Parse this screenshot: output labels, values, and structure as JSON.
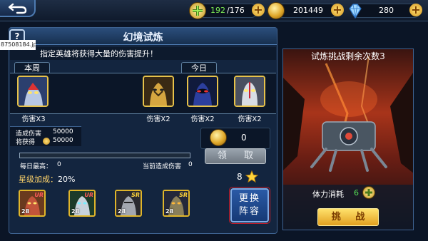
{
  "topbar": {
    "stamina_current": "192",
    "stamina_max": "/176",
    "gold": "201449",
    "diamonds": "280"
  },
  "window": {
    "title": "幻境试炼",
    "help_label": "?",
    "image_tooltip": "87508184.jpg",
    "description": "指定英雄将获得大量的伤害提升！"
  },
  "weekly": {
    "tab_label": "本周",
    "heroes": [
      {
        "icon": "hero-portrait-icon",
        "multiplier": "伤害X3"
      }
    ]
  },
  "today": {
    "tab_label": "今日",
    "heroes": [
      {
        "icon": "hero-portrait-icon",
        "multiplier": "伤害X2"
      },
      {
        "icon": "hero-portrait-icon",
        "multiplier": "伤害X2"
      },
      {
        "icon": "hero-portrait-icon",
        "multiplier": "伤害X2"
      }
    ]
  },
  "damage": {
    "dealt_label": "造成伤害",
    "dealt_value": "50000",
    "earn_label": "将获得",
    "earn_value": "50000"
  },
  "reward": {
    "count": "0",
    "claim_label": "领 取"
  },
  "progress": {
    "fill_fraction": 0.0,
    "daily_max_label": "每日最高：",
    "daily_max_value": "0",
    "current_label": "当前造成伤害",
    "current_value": "0"
  },
  "star_bonus": {
    "label": "星级加成：",
    "value": "20%",
    "star_count": "8"
  },
  "lineup": {
    "cards": [
      {
        "level": "28",
        "rank": "UR",
        "rank_color": "#ff5a5a"
      },
      {
        "level": "28",
        "rank": "UR",
        "rank_color": "#ff5a5a"
      },
      {
        "level": "28",
        "rank": "SR",
        "rank_color": "#ffd43b"
      },
      {
        "level": "28",
        "rank": "SR",
        "rank_color": "#ffd43b"
      }
    ],
    "change_label_1": "更换",
    "change_label_2": "阵容"
  },
  "challenge": {
    "remaining_label": "试炼挑战剩余次数3",
    "stamina_cost_label": "体力消耗",
    "stamina_cost_value": "6",
    "button_label": "挑 战"
  },
  "colors": {
    "accent_gold": "#e7c24a",
    "panel_bg": "#13253f",
    "stamina_green": "#55e055"
  }
}
